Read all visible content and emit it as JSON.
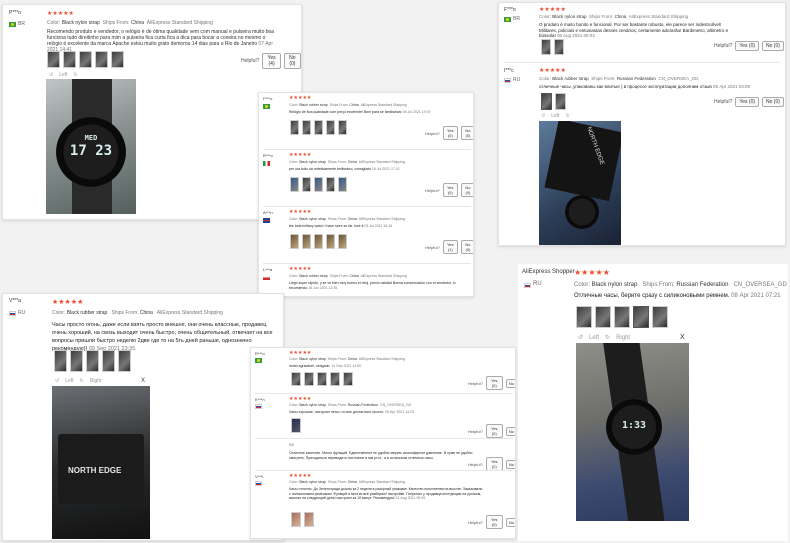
{
  "common": {
    "helpful": "Helpful?",
    "yes": "Yes (0)",
    "no": "No (0)",
    "left": "Left",
    "right": "Right",
    "close": "X",
    "star_glyphs": "★★★★★"
  },
  "card1": {
    "user": "P***o",
    "country_code": "BR",
    "color_label": "Color:",
    "color": "Black nylon strap",
    "ships_label": "Ships From:",
    "ships": "China",
    "shipping": "AliExpress Standard Shipping",
    "text": "Recomendo produto e vendedor, o relógio é de ótima qualidade vem com manual e pulseira muito boa funciona tudo direitinho para mim a pulseira fica curta fica a dica para bocar a coxeira no mesmo o relógio é excelente da marca Apache estou muito grato demorou 14 dias para o Rio de Janeiro",
    "date": "07 Apr 2021 14:41",
    "helpful_yes": "Yes (4)",
    "helpful_no": "No (0)",
    "lcd_top": "MED",
    "lcd_main": "17 23"
  },
  "card2": {
    "user": "F***o",
    "country_code": "BR",
    "color": "Black nylon strap",
    "ships": "China",
    "shipping": "AliExpress Standard Shipping",
    "text": "O produto é muito bonito e funcional. Por ser bastante robusto, ele parece ser indestrutível! Militares, policiais e entusiastas desses cenários, certamente adorarão! Bardimetro, altimetro e bússola!",
    "date": "06 Aug 2021 05:02"
  },
  "card3": {
    "user": "I***c",
    "country_code": "RU",
    "color": "Black rubber strap",
    "ships": "Russian Federation",
    "shipping": "CN_OVERSEA_GD",
    "text": "отличные часы, упакованы как влитые ) в процессе эксплуатации дополним отзыв",
    "date": "09 Apr 2021 03:09",
    "box_label": "NORTH EDGE"
  },
  "card4": {
    "reviews": [
      {
        "user": "F***o",
        "country_code": "BR",
        "color": "Black rubber strap",
        "ships": "China",
        "shipping": "AliExpress Standard Shipping",
        "text": "Relógio de boa qualidade com preço excelente! Bom para se familiarizar",
        "date": "05 Jul 2021 19:19",
        "helpful_yes": "Yes (0)",
        "helpful_no": "No (0)"
      },
      {
        "user": "R***o",
        "country_code": "IT",
        "color": "Black nylon strap",
        "ships": "China",
        "shipping": "AliExpress Standard Shipping",
        "text": "per ora tutto ciò esteticamente bellissimo, consigliato",
        "date": "16 Jul 2021 17:21",
        "helpful_yes": "Yes (0)",
        "helpful_no": "No (0)"
      },
      {
        "user": "A***n",
        "country_code": "UK",
        "color": "Black nylon strap",
        "ships": "China",
        "shipping": "AliExpress Standard Shipping",
        "text": "the best military watch I have seen so far. love it",
        "date": "03 Jul 2021 16:15",
        "helpful_yes": "Yes (1)",
        "helpful_no": "No (0)"
      },
      {
        "user": "L***a",
        "country_code": "CL",
        "color": "Black rubber strap",
        "ships": "China",
        "shipping": "AliExpress Standard Shipping",
        "text": "Llegó super rápido, y se ve bien muy bueno el reloj. precio calidad Buena comunicación con el vendedor, lo recomiendo",
        "date": "16 Jun 2021 12:36"
      }
    ]
  },
  "card5": {
    "user": "V***a",
    "country_code": "RU",
    "color": "Black rubber strap",
    "ships": "China",
    "shipping": "AliExpress Standard Shipping",
    "text": "Часы просто огонь, даже если взять просто внешне, они очень классные, продавец очень хороший, на связь выходит очень быстро, очень общительный, отвечает на все вопросы пришли быстро неделю 2две где то на 5ть дней раньше, однозначно рекомендую))",
    "date": "09 Sep 2021 23:35",
    "box_label": "NORTH EDGE"
  },
  "card6": {
    "reviews": [
      {
        "user": "R***o",
        "country_code": "BR",
        "color": "Black nylon strap",
        "ships": "China",
        "shipping": "AliExpress Standard Shipping",
        "text": "muito agradável, obrigado.",
        "date": "14 Sep 2021 14:50",
        "helpful_yes": "Yes (0)",
        "helpful_no": "No"
      },
      {
        "user": "K***n",
        "country_code": "RU",
        "color": "Black nylon strap",
        "ships": "Russian Federation",
        "shipping": "CN_OVERSEA_GD",
        "text": "Часы хорошие, настроил легко, но все достаточно просто.",
        "date": "06 Apr 2021 14:23",
        "helpful_yes": "Yes (0)",
        "helpful_no": "No"
      },
      {
        "user": "",
        "country_code": "",
        "color": "",
        "ships": "",
        "shipping": "",
        "text": "Отличное качество. Много функций. Единственное не удобно мерять атмосферное давление. В луже не удобно смотреть. Приходиться переводить постоянно в мм.рт.ст., а в остальном отличные часы.",
        "date": "",
        "helpful_yes": "Yes (2)",
        "helpful_no": "No",
        "tag": "8/8"
      },
      {
        "user": "V***l",
        "country_code": "RU",
        "color": "Black nylon strap",
        "ships": "China",
        "shipping": "AliExpress Standard Shipping",
        "text": "Часы отлично. До Зеленограда дошли за 2 недели в разорный упаковке. Качество исполнения на высоте. Заказывали с силиконовым ремешком. Функций я многих всё разбираю! настройки. Попросил у продавца инструкцию на русском, выслал на следующий день! настроил за 10 минут. Рекомендую!",
        "date": "21 Aug 2021 06:09",
        "helpful_yes": "Yes (0)",
        "helpful_no": "No"
      }
    ]
  },
  "card7": {
    "reviewer_name": "AliExpress Shopper",
    "country_code": "RU",
    "color": "Black nylon strap",
    "ships": "Russian Federation",
    "shipping": "CN_OVERSEA_GD",
    "text": "Отличные часы, берите сразу с силиконовыми ремнем.",
    "date": "08 Apr 2021 07:21",
    "lcd_main": "1:33"
  },
  "colors": {
    "star": "#f04a2e",
    "button_border": "#aaa",
    "meta": "#777"
  }
}
